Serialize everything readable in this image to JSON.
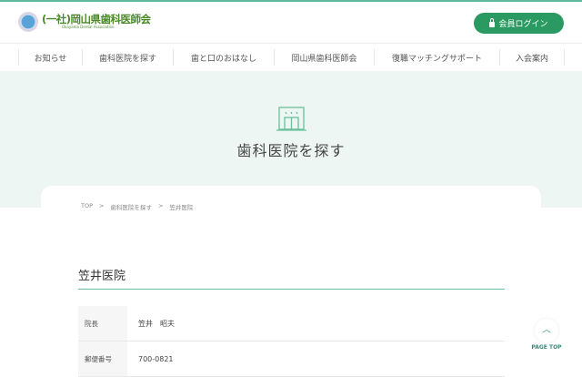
{
  "header": {
    "logo_text": "(一社)岡山県歯科医師会",
    "logo_subtext": "Okayama Dental Association",
    "login_label": "会員ログイン"
  },
  "nav": {
    "items": [
      {
        "label": "お知らせ"
      },
      {
        "label": "歯科医院を探す"
      },
      {
        "label": "歯と口のおはなし"
      },
      {
        "label": "岡山県歯科医師会"
      },
      {
        "label": "復職マッチングサポート"
      },
      {
        "label": "入会案内"
      }
    ]
  },
  "hero": {
    "title": "歯科医院を探す"
  },
  "breadcrumb": {
    "items": [
      "TOP",
      "歯科医院を探す",
      "笠井医院"
    ],
    "separator": ">"
  },
  "clinic": {
    "name": "笠井医院",
    "rows": [
      {
        "label": "院長",
        "value": "笠井　昭夫"
      },
      {
        "label": "郵便番号",
        "value": "700-0821"
      }
    ]
  },
  "page_top": {
    "label": "PAGE TOP"
  }
}
